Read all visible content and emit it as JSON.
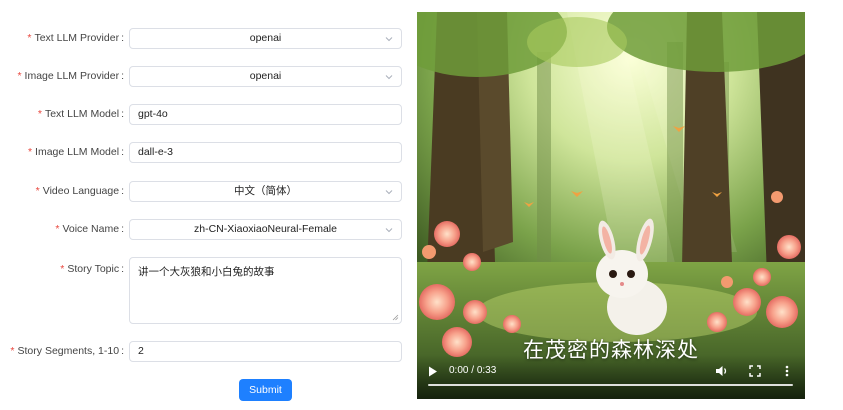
{
  "form": {
    "fields": [
      {
        "label": "Text LLM Provider",
        "value": "openai",
        "type": "select"
      },
      {
        "label": "Image LLM Provider",
        "value": "openai",
        "type": "select"
      },
      {
        "label": "Text LLM Model",
        "value": "gpt-4o",
        "type": "input"
      },
      {
        "label": "Image LLM Model",
        "value": "dall-e-3",
        "type": "input"
      },
      {
        "label": "Video Language",
        "value": "中文（简体）",
        "type": "select"
      },
      {
        "label": "Voice Name",
        "value": "zh-CN-XiaoxiaoNeural-Female",
        "type": "select"
      },
      {
        "label": "Story Topic",
        "value": "讲一个大灰狼和小白兔的故事",
        "type": "textarea"
      },
      {
        "label": "Story Segments, 1-10",
        "value": "2",
        "type": "input"
      }
    ],
    "required_mark": "*",
    "colon": ":",
    "submit_label": "Submit",
    "accent_color": "#1e80ff",
    "required_color": "#e8453c"
  },
  "video": {
    "subtitle": "在茂密的森林深处",
    "current_time": "0:00",
    "duration": "0:33",
    "time_separator": " / ",
    "progress_fraction": 0.0,
    "icons": [
      "play-icon",
      "volume-icon",
      "fullscreen-icon",
      "more-options-icon"
    ]
  }
}
